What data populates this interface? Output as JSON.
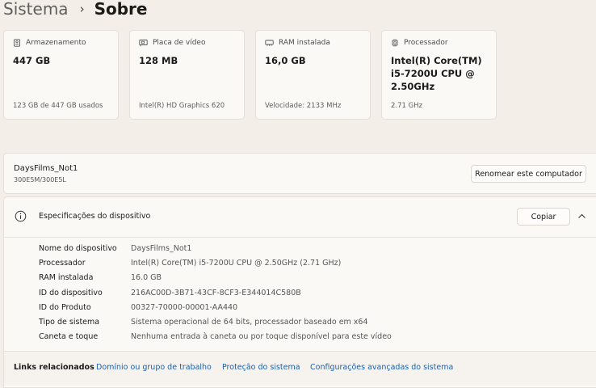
{
  "breadcrumb": {
    "parent": "Sistema",
    "separator": "›",
    "current": "Sobre"
  },
  "cards": [
    {
      "icon": "storage-icon",
      "label": "Armazenamento",
      "value": "447 GB",
      "detail": "123 GB de 447 GB usados"
    },
    {
      "icon": "video-card-icon",
      "label": "Placa de vídeo",
      "value": "128 MB",
      "detail": "Intel(R) HD Graphics 620"
    },
    {
      "icon": "ram-icon",
      "label": "RAM instalada",
      "value": "16,0 GB",
      "detail": "Velocidade: 2133 MHz"
    },
    {
      "icon": "processor-icon",
      "label": "Processador",
      "value": "Intel(R) Core(TM) i5-7200U CPU @ 2.50GHz",
      "detail": "2.71 GHz"
    }
  ],
  "device": {
    "name": "DaysFilms_Not1",
    "model": "300E5M/300E5L",
    "rename_label": "Renomear este computador"
  },
  "specs": {
    "title": "Especificações do dispositivo",
    "copy_label": "Copiar",
    "rows": [
      {
        "label": "Nome do dispositivo",
        "value": "DaysFilms_Not1"
      },
      {
        "label": "Processador",
        "value": "Intel(R) Core(TM) i5-7200U CPU @ 2.50GHz (2.71 GHz)"
      },
      {
        "label": "RAM instalada",
        "value": "16.0 GB"
      },
      {
        "label": "ID do dispositivo",
        "value": "216AC00D-3B71-43CF-8CF3-E344014C580B"
      },
      {
        "label": "ID do Produto",
        "value": "00327-70000-00001-AA440"
      },
      {
        "label": "Tipo de sistema",
        "value": "Sistema operacional de 64 bits, processador baseado em x64"
      },
      {
        "label": "Caneta e toque",
        "value": "Nenhuma entrada à caneta ou por toque disponível para este vídeo"
      }
    ]
  },
  "related": {
    "label": "Links relacionados",
    "links": [
      "Domínio ou grupo de trabalho",
      "Proteção do sistema",
      "Configurações avançadas do sistema"
    ]
  },
  "colors": {
    "background": "#f3efe8",
    "card": "#fbf9f6",
    "link": "#1b5fad"
  }
}
